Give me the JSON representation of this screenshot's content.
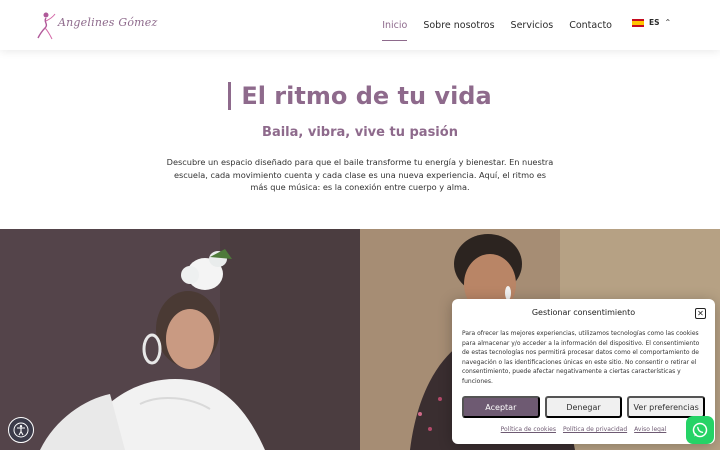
{
  "brand": {
    "name": "Angelines Gómez"
  },
  "nav": {
    "items": [
      {
        "label": "Inicio",
        "active": true
      },
      {
        "label": "Sobre nosotros",
        "active": false
      },
      {
        "label": "Servicios",
        "active": false
      },
      {
        "label": "Contacto",
        "active": false
      }
    ],
    "language": {
      "code": "ES",
      "flag": "spain-flag-icon"
    }
  },
  "hero": {
    "title": "El ritmo de tu vida",
    "subtitle": "Baila, vibra, vive tu pasión",
    "description": "Descubre un espacio diseñado para que el baile transforme tu energía y bienestar. En nuestra escuela, cada movimiento cuenta y cada clase es una nueva experiencia. Aquí, el ritmo es más que música: es la conexión entre cuerpo y alma."
  },
  "cookie": {
    "title": "Gestionar consentimiento",
    "body": "Para ofrecer las mejores experiencias, utilizamos tecnologías como las cookies para almacenar y/o acceder a la información del dispositivo. El consentimiento de estas tecnologías nos permitirá procesar datos como el comportamiento de navegación o las identificaciones únicas en este sitio. No consentir o retirar el consentimiento, puede afectar negativamente a ciertas características y funciones.",
    "accept_label": "Aceptar",
    "deny_label": "Denegar",
    "preferences_label": "Ver preferencias",
    "links": [
      "Política de cookies",
      "Política de privacidad",
      "Aviso legal"
    ]
  },
  "colors": {
    "accent": "#8e6a8c",
    "button_primary": "#6e5a72",
    "whatsapp": "#25d366"
  },
  "icons": {
    "accessibility": "accessibility-icon",
    "whatsapp": "whatsapp-icon",
    "close": "close-icon",
    "language_chevron": "chevron-up-icon"
  }
}
